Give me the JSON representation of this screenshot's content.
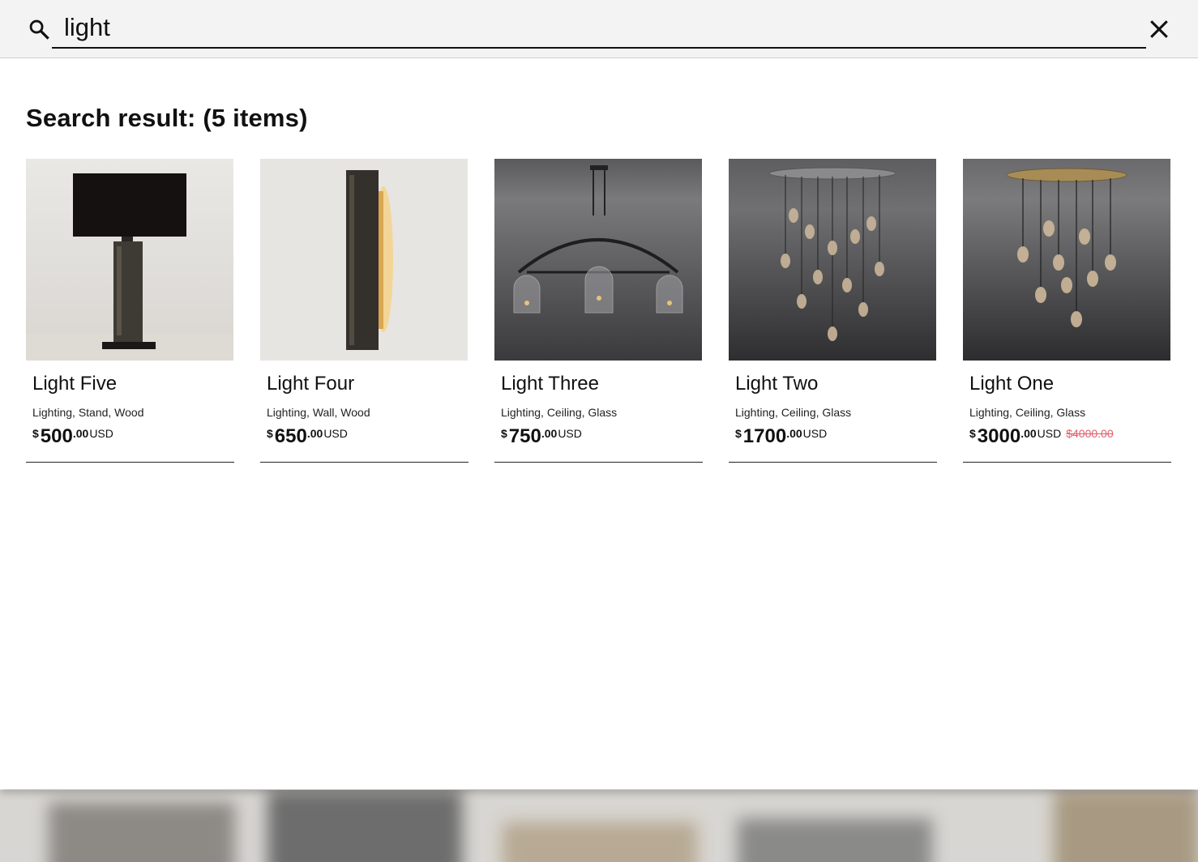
{
  "search": {
    "query": "light",
    "placeholder": "Search"
  },
  "results": {
    "title": "Search result: (5 items)"
  },
  "products": [
    {
      "name": "Light Five",
      "tags": "Lighting, Stand, Wood",
      "currency_symbol": "$",
      "price_int": "500",
      "price_dec": ".00",
      "currency_code": "USD",
      "old_price": ""
    },
    {
      "name": "Light Four",
      "tags": "Lighting, Wall, Wood",
      "currency_symbol": "$",
      "price_int": "650",
      "price_dec": ".00",
      "currency_code": "USD",
      "old_price": ""
    },
    {
      "name": "Light Three",
      "tags": "Lighting, Ceiling, Glass",
      "currency_symbol": "$",
      "price_int": "750",
      "price_dec": ".00",
      "currency_code": "USD",
      "old_price": ""
    },
    {
      "name": "Light Two",
      "tags": "Lighting, Ceiling, Glass",
      "currency_symbol": "$",
      "price_int": "1700",
      "price_dec": ".00",
      "currency_code": "USD",
      "old_price": ""
    },
    {
      "name": "Light One",
      "tags": "Lighting, Ceiling, Glass",
      "currency_symbol": "$",
      "price_int": "3000",
      "price_dec": ".00",
      "currency_code": "USD",
      "old_price": "$4000.00"
    }
  ],
  "colors": {
    "search_bar_bg": "#f3f3f3",
    "sale_price": "#e06068",
    "text": "#111111"
  },
  "icons": {
    "search": "search-icon",
    "close": "close-icon"
  }
}
